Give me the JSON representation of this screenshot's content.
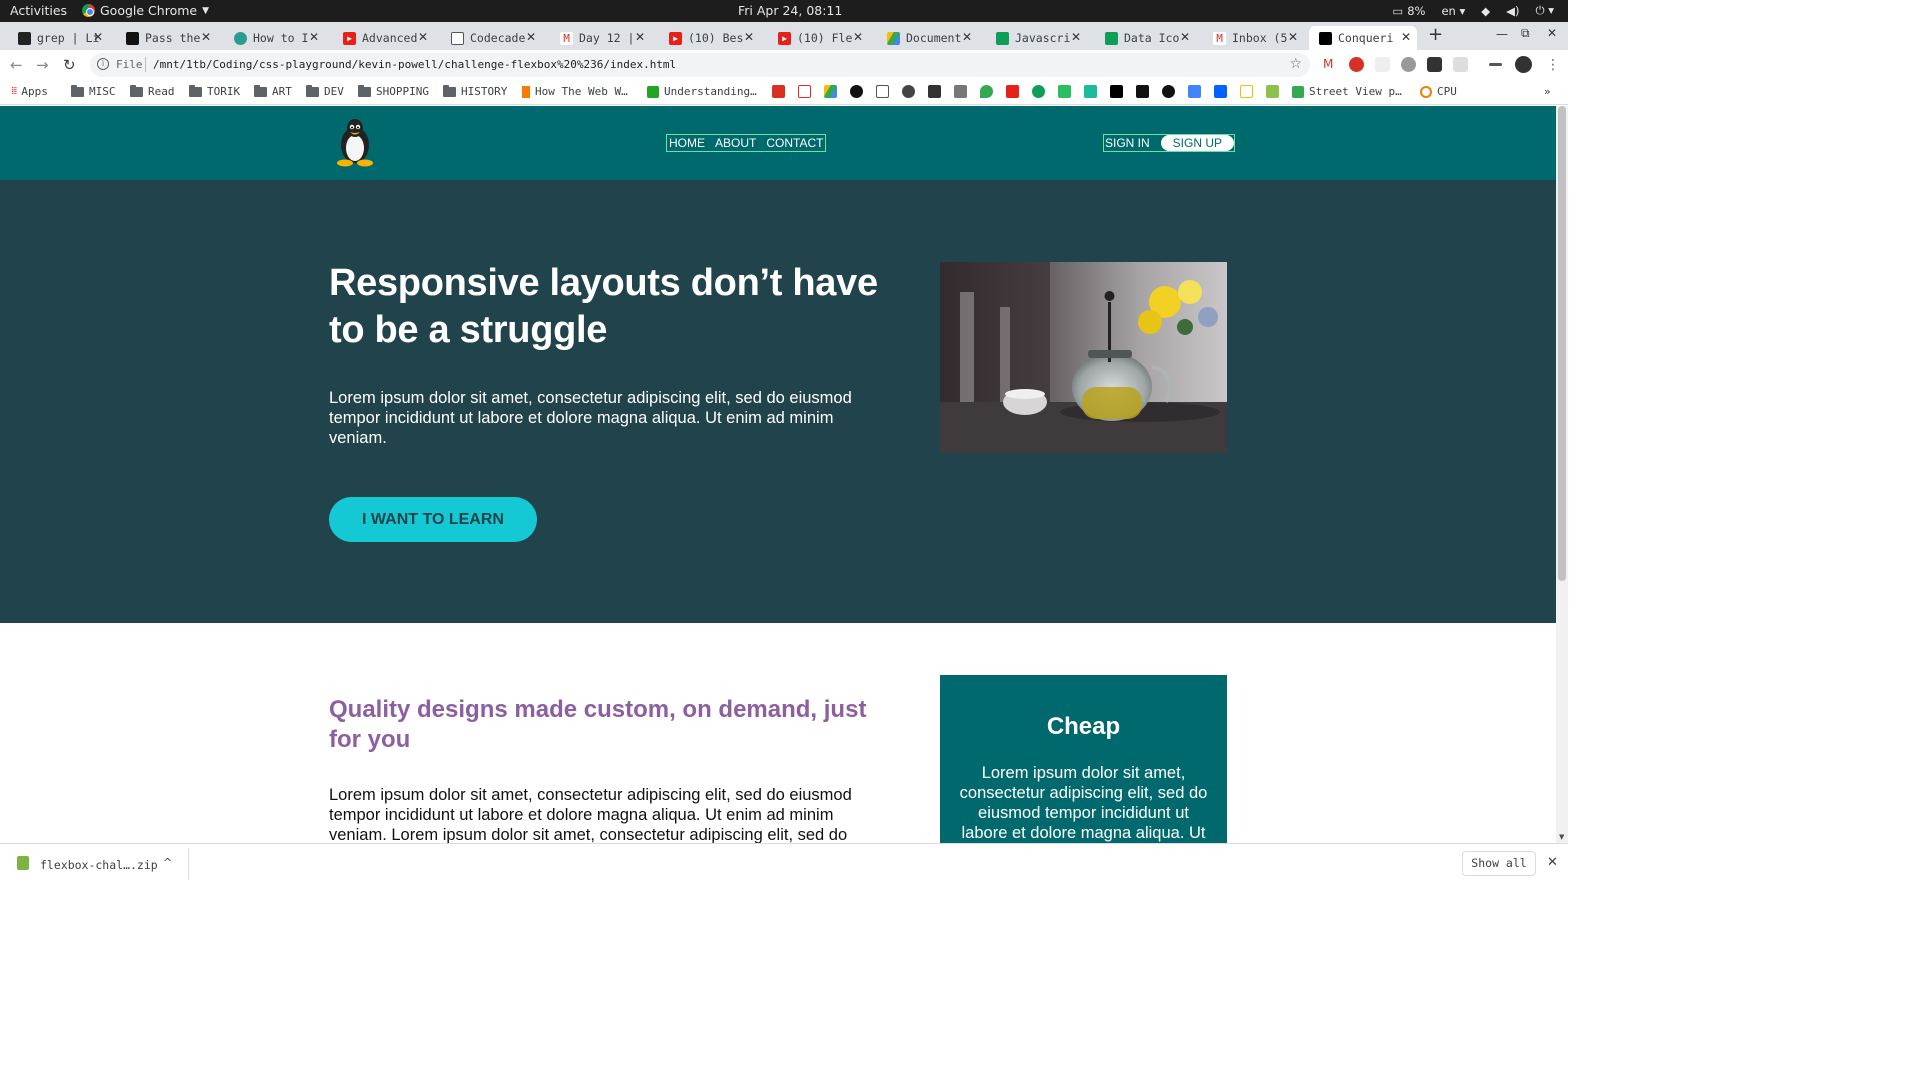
{
  "gnome": {
    "activities": "Activities",
    "app_name": "Google Chrome",
    "clock": "Fri Apr 24, 08:11",
    "battery": "8%",
    "language": "en"
  },
  "tabs": [
    {
      "title": "grep | Li",
      "color": "#222"
    },
    {
      "title": "Pass the",
      "color": "#111"
    },
    {
      "title": "How to I",
      "color": "#2a9d8f"
    },
    {
      "title": "Advanced",
      "color": "#e62117"
    },
    {
      "title": "Codecade",
      "color": "#555"
    },
    {
      "title": "Day 12 |",
      "color": "#d93025"
    },
    {
      "title": "(10) Bes",
      "color": "#e62117"
    },
    {
      "title": "(10) Fle",
      "color": "#e62117"
    },
    {
      "title": "Document",
      "color": "#1a73e8"
    },
    {
      "title": "Javascri",
      "color": "#0f9d58"
    },
    {
      "title": "Data Ico",
      "color": "#0f9d58"
    },
    {
      "title": "Inbox (5",
      "color": "#d93025"
    },
    {
      "title": "Conqueri",
      "color": "#000"
    }
  ],
  "omnibox": {
    "scheme_label": "File",
    "url": "/mnt/1tb/Coding/css-playground/kevin-powell/challenge-flexbox%20%236/index.html"
  },
  "bookmarks": {
    "apps": "Apps",
    "folders": [
      "MISC",
      "Read",
      "TORIK",
      "ART",
      "DEV",
      "SHOPPING",
      "HISTORY"
    ],
    "links": [
      "How The Web W…",
      "Understanding…",
      "Street View p…",
      "CPU"
    ]
  },
  "site": {
    "nav": [
      "HOME",
      "ABOUT",
      "CONTACT"
    ],
    "sign_in": "SIGN IN",
    "sign_up": "SIGN UP",
    "hero_title": "Responsive layouts don’t have to be a struggle",
    "hero_text": "Lorem ipsum dolor sit amet, consectetur adipiscing elit, sed do eiusmod tempor incididunt ut labore et dolore magna aliqua. Ut enim ad minim veniam.",
    "cta": "I WANT TO LEARN",
    "section_title": "Quality designs made custom, on demand, just for you",
    "section_text": "Lorem ipsum dolor sit amet, consectetur adipiscing elit, sed do eiusmod tempor incididunt ut labore et dolore magna aliqua. Ut enim ad minim veniam. Lorem ipsum dolor sit amet, consectetur adipiscing elit, sed do eiusmod tempor incididunt ut labore et dolore magna aliqua. Ut enim ad",
    "card_title": "Cheap",
    "card_text": "Lorem ipsum dolor sit amet, consectetur adipiscing elit, sed do eiusmod tempor incididunt ut labore et dolore magna aliqua. Ut enim ad minim veniam."
  },
  "colors": {
    "header": "#00696e",
    "hero": "#21434b",
    "cta": "#14c8d4",
    "section_title": "#8b5fa0"
  },
  "downloads": {
    "file": "flexbox-chal….zip",
    "show_all": "Show all"
  }
}
